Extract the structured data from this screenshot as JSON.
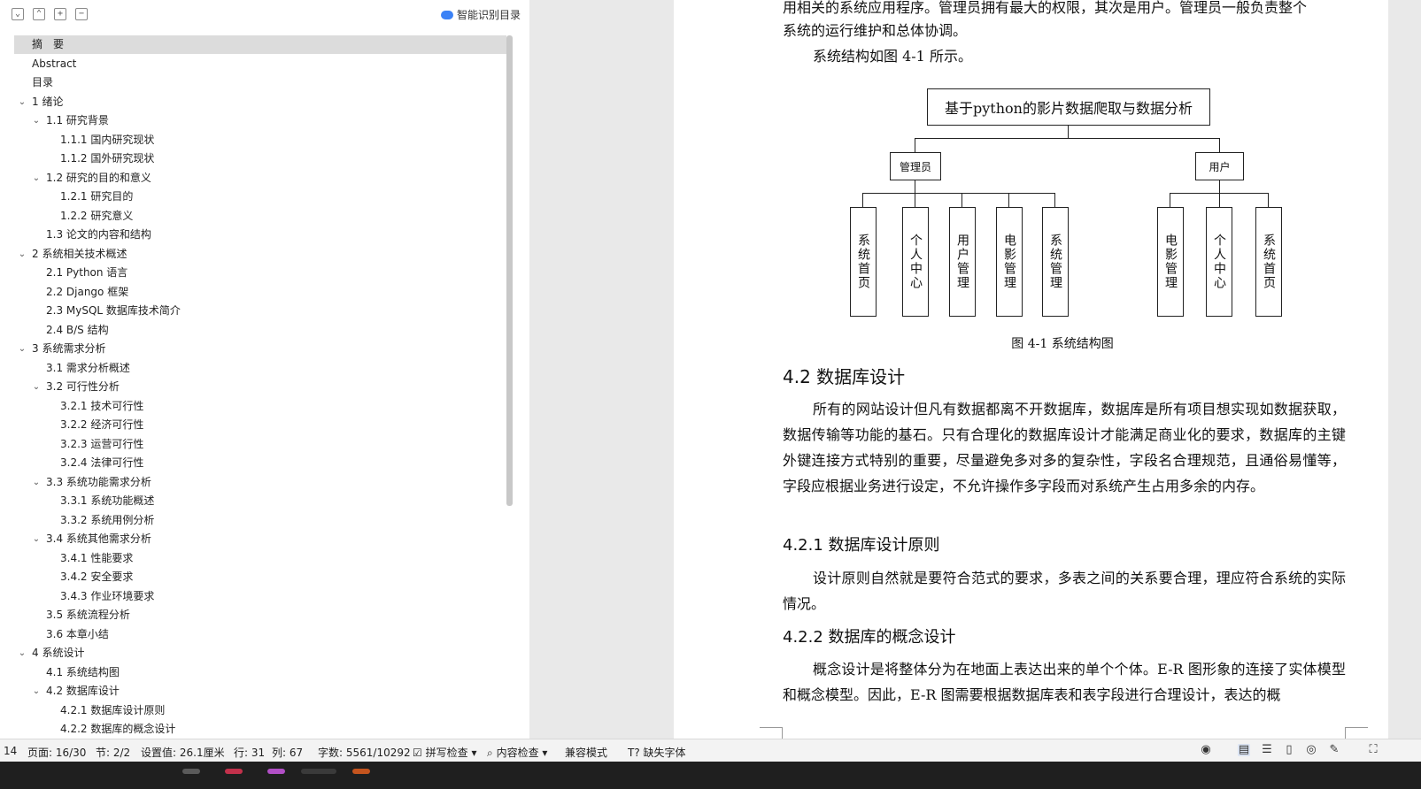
{
  "nav": {
    "smart_toc": "智能识别目录",
    "toolbar_icons": [
      "expand-all-icon",
      "collapse-all-icon",
      "plus-icon",
      "minus-icon"
    ],
    "items": [
      {
        "label": "摘　要",
        "level": 0,
        "active": true,
        "chevron": false
      },
      {
        "label": "Abstract",
        "level": 0,
        "chevron": false
      },
      {
        "label": "目录",
        "level": 0,
        "chevron": false
      },
      {
        "label": "1 绪论",
        "level": 0,
        "chevron": true
      },
      {
        "label": "1.1  研究背景",
        "level": 1,
        "chevron": true
      },
      {
        "label": "1.1.1 国内研究现状",
        "level": 2,
        "chevron": false
      },
      {
        "label": "1.1.2 国外研究现状",
        "level": 2,
        "chevron": false
      },
      {
        "label": "1.2 研究的目的和意义",
        "level": 1,
        "chevron": true
      },
      {
        "label": "1.2.1 研究目的",
        "level": 2,
        "chevron": false
      },
      {
        "label": "1.2.2  研究意义",
        "level": 2,
        "chevron": false
      },
      {
        "label": "1.3  论文的内容和结构",
        "level": 1,
        "chevron": false
      },
      {
        "label": "2 系统相关技术概述",
        "level": 0,
        "chevron": true
      },
      {
        "label": "2.1 Python 语言",
        "level": 1,
        "chevron": false
      },
      {
        "label": "2.2 Django 框架",
        "level": 1,
        "chevron": false
      },
      {
        "label": "2.3 MySQL 数据库技术简介",
        "level": 1,
        "chevron": false
      },
      {
        "label": "2.4 B/S 结构",
        "level": 1,
        "chevron": false
      },
      {
        "label": "3 系统需求分析",
        "level": 0,
        "chevron": true
      },
      {
        "label": "3.1 需求分析概述",
        "level": 1,
        "chevron": false
      },
      {
        "label": "3.2 可行性分析",
        "level": 1,
        "chevron": true
      },
      {
        "label": "3.2.1 技术可行性",
        "level": 2,
        "chevron": false
      },
      {
        "label": "3.2.2 经济可行性",
        "level": 2,
        "chevron": false
      },
      {
        "label": "3.2.3 运营可行性",
        "level": 2,
        "chevron": false
      },
      {
        "label": "3.2.4 法律可行性",
        "level": 2,
        "chevron": false
      },
      {
        "label": "3.3 系统功能需求分析",
        "level": 1,
        "chevron": true
      },
      {
        "label": "3.3.1 系统功能概述",
        "level": 2,
        "chevron": false
      },
      {
        "label": "3.3.2 系统用例分析",
        "level": 2,
        "chevron": false
      },
      {
        "label": "3.4 系统其他需求分析",
        "level": 1,
        "chevron": true
      },
      {
        "label": "3.4.1 性能要求",
        "level": 2,
        "chevron": false
      },
      {
        "label": "3.4.2 安全要求",
        "level": 2,
        "chevron": false
      },
      {
        "label": "3.4.3 作业环境要求",
        "level": 2,
        "chevron": false
      },
      {
        "label": "3.5 系统流程分析",
        "level": 1,
        "chevron": false
      },
      {
        "label": "3.6 本章小结",
        "level": 1,
        "chevron": false
      },
      {
        "label": "4  系统设计",
        "level": 0,
        "chevron": true
      },
      {
        "label": "4.1 系统结构图",
        "level": 1,
        "chevron": false
      },
      {
        "label": "4.2 数据库设计",
        "level": 1,
        "chevron": true
      },
      {
        "label": "4.2.1 数据库设计原则",
        "level": 2,
        "chevron": false
      },
      {
        "label": "4.2.2 数据库的概念设计",
        "level": 2,
        "chevron": false
      }
    ]
  },
  "doc": {
    "intro_lines": [
      "用相关的系统应用程序。管理员拥有最大的权限，其次是用户。管理员一般负责整个",
      "系统的运行维护和总体协调。"
    ],
    "structure_ref": "系统结构如图 4-1 所示。",
    "diagram": {
      "root": "基于python的影片数据爬取与数据分析",
      "admin": "管理员",
      "user": "用户",
      "admin_leaves": [
        "系统首页",
        "个人中心",
        "用户管理",
        "电影管理",
        "系统管理"
      ],
      "user_leaves": [
        "电影管理",
        "个人中心",
        "系统首页"
      ]
    },
    "caption": "图 4-1 系统结构图",
    "h_db": "4.2 数据库设计",
    "db_para": "所有的网站设计但凡有数据都离不开数据库，数据库是所有项目想实现如数据获取，数据传输等功能的基石。只有合理化的数据库设计才能满足商业化的要求，数据库的主键外键连接方式特别的重要，尽量避免多对多的复杂性，字段名合理规范，且通俗易懂等，字段应根据业务进行设定，不允许操作多字段而对系统产生占用多余的内存。",
    "h_principle": "4.2.1 数据库设计原则",
    "principle_para": "设计原则自然就是要符合范式的要求，多表之间的关系要合理，理应符合系统的实际情况。",
    "h_concept": "4.2.2 数据库的概念设计",
    "concept_para": "概念设计是将整体分为在地面上表达出来的单个个体。E-R 图形象的连接了实体模型和概念模型。因此，E-R 图需要根据数据库表和表字段进行合理设计，表达的概"
  },
  "status": {
    "left_num": "14",
    "page": "页面: 16/30",
    "section": "节: 2/2",
    "setting": "设置值: 26.1厘米",
    "row": "行: 31",
    "col": "列: 67",
    "words": "字数: 5561/10292",
    "spell": "拼写检查",
    "content": "内容检查",
    "compat": "兼容模式",
    "missing_font": "缺失字体"
  }
}
